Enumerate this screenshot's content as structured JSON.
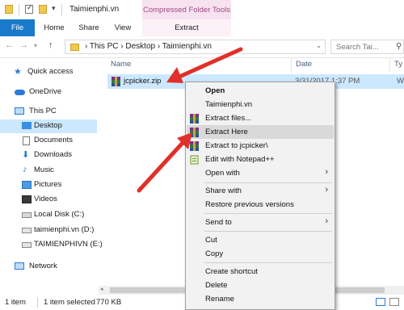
{
  "titlebar": {
    "title": "Taimienphi.vn",
    "context_tab_group": "Compressed Folder Tools",
    "qa_arrow": "▾"
  },
  "ribbon": {
    "tabs": [
      "File",
      "Home",
      "Share",
      "View",
      "Extract"
    ]
  },
  "nav_buttons": {
    "back": "←",
    "forward": "→",
    "recent": "▾",
    "up": "↑"
  },
  "address": {
    "path": "›  This PC  ›  Desktop  ›  Taimienphi.vn",
    "dropdown": "⌄",
    "refresh": "↻"
  },
  "search": {
    "placeholder": "Search Tai...",
    "icon": "⚲"
  },
  "nav_pane": {
    "items": [
      {
        "label": "Quick access",
        "icon": "star-icon"
      },
      {
        "label": "OneDrive",
        "icon": "cloud-icon"
      },
      {
        "label": "This PC",
        "icon": "computer-icon"
      },
      {
        "label": "Desktop",
        "icon": "desktop-icon",
        "selected": true
      },
      {
        "label": "Documents",
        "icon": "documents-icon"
      },
      {
        "label": "Downloads",
        "icon": "downloads-icon"
      },
      {
        "label": "Music",
        "icon": "music-icon"
      },
      {
        "label": "Pictures",
        "icon": "pictures-icon"
      },
      {
        "label": "Videos",
        "icon": "videos-icon"
      },
      {
        "label": "Local Disk (C:)",
        "icon": "drive-icon"
      },
      {
        "label": "taimienphi.vn (D:)",
        "icon": "drive-icon"
      },
      {
        "label": "TAIMIENPHIVN (E:)",
        "icon": "drive-icon"
      },
      {
        "label": "Network",
        "icon": "network-icon"
      }
    ]
  },
  "columns": {
    "name": "Name",
    "date": "Date",
    "type": "Ty"
  },
  "file": {
    "name": "jcpicker.zip",
    "date": "3/31/2017 1:37 PM",
    "type": "Wi"
  },
  "context_menu": {
    "open": "Open",
    "taimienphi": "Taimienphi.vn",
    "extract_files": "Extract files...",
    "extract_here": "Extract Here",
    "extract_to": "Extract to jcpicker\\",
    "edit_notepad": "Edit with Notepad++",
    "open_with": "Open with",
    "share_with": "Share with",
    "restore": "Restore previous versions",
    "send_to": "Send to",
    "cut": "Cut",
    "copy": "Copy",
    "create_shortcut": "Create shortcut",
    "delete": "Delete",
    "rename": "Rename",
    "submenu_glyph": "›"
  },
  "status": {
    "count": "1 item",
    "selected": "1 item selected",
    "size": "770 KB"
  },
  "scroll": {
    "left": "◂"
  },
  "colors": {
    "accent": "#1979ca",
    "selection": "#cce8ff",
    "arrow": "#e0302a",
    "context_tab": "#a24a86"
  }
}
